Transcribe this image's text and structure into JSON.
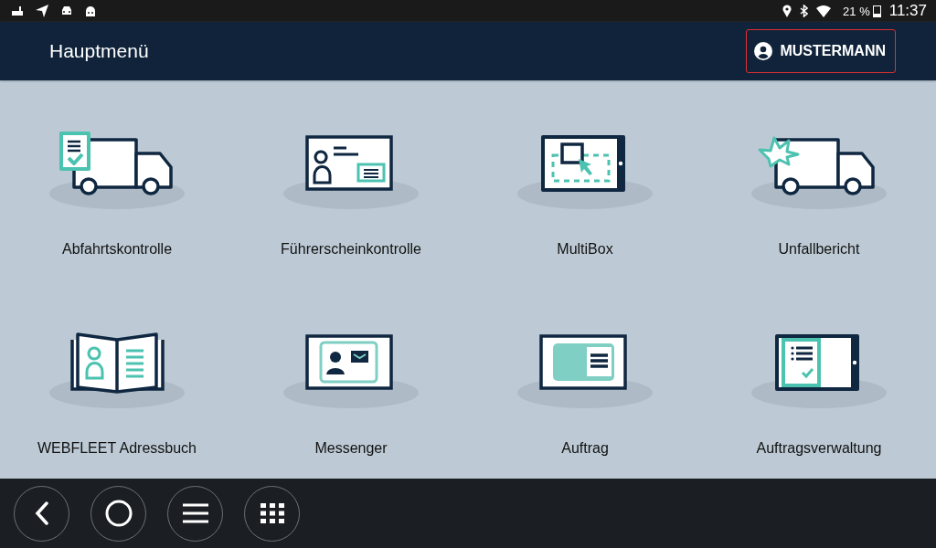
{
  "status_bar": {
    "battery": "21 %",
    "time": "11:37"
  },
  "header": {
    "title": "Hauptmenü",
    "user_button": "MUSTERMANN"
  },
  "tiles": [
    {
      "kind": "truck-check",
      "label": "Abfahrtskontrolle"
    },
    {
      "kind": "id-card",
      "label": "Führerscheinkontrolle"
    },
    {
      "kind": "tablet-select",
      "label": "MultiBox"
    },
    {
      "kind": "truck-crash",
      "label": "Unfallbericht"
    },
    {
      "kind": "address-book",
      "label": "WEBFLEET Adressbuch"
    },
    {
      "kind": "message-card",
      "label": "Messenger"
    },
    {
      "kind": "order-card",
      "label": "Auftrag"
    },
    {
      "kind": "tablet-list",
      "label": "Auftragsverwaltung"
    }
  ]
}
